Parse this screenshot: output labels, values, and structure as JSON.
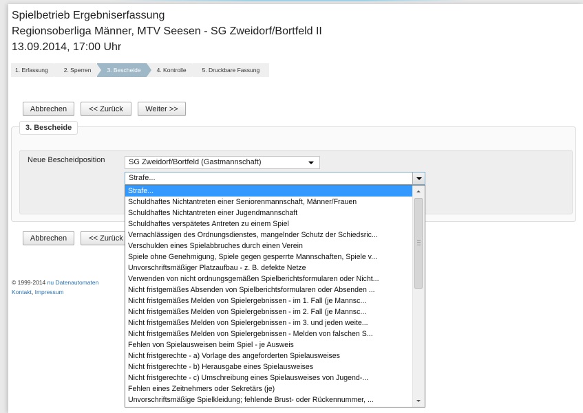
{
  "header": {
    "line1": "Spielbetrieb Ergebniserfassung",
    "line2": "Regionsoberliga Männer, MTV Seesen - SG Zweidorf/Bortfeld II",
    "line3": "13.09.2014, 17:00 Uhr"
  },
  "steps": [
    {
      "label": "1. Erfassung",
      "active": false
    },
    {
      "label": "2. Sperren",
      "active": false
    },
    {
      "label": "3. Bescheide",
      "active": true
    },
    {
      "label": "4. Kontrolle",
      "active": false
    },
    {
      "label": "5. Druckbare Fassung",
      "active": false
    }
  ],
  "buttons": {
    "cancel": "Abbrechen",
    "back": "<< Zurück",
    "next": "Weiter >>"
  },
  "section": {
    "legend": "3. Bescheide",
    "field_label": "Neue Bescheidposition",
    "team_select_value": "SG Zweidorf/Bortfeld (Gastmannschaft)",
    "strafe_select_value": "Strafe..."
  },
  "strafe_options": [
    "Strafe...",
    "Schuldhaftes Nichtantreten einer Seniorenmannschaft, Männer/Frauen",
    "Schuldhaftes Nichtantreten einer Jugendmannschaft",
    "Schuldhaftes verspätetes Antreten zu einem Spiel",
    "Vernachlässigen des Ordnungsdienstes, mangelnder Schutz der Schiedsric...",
    "Verschulden eines Spielabbruches durch einen Verein",
    "Spiele ohne Genehmigung, Spiele gegen gesperrte Mannschaften, Spiele v...",
    "Unvorschriftsmäßiger Platzaufbau - z. B. defekte Netze",
    "Verwenden von nicht ordnungsgemäßen Spielberichtsformularen oder Nicht...",
    "Nicht fristgemäßes Absenden von Spielberichtsformularen oder Absenden ...",
    "Nicht fristgemäßes Melden von Spielergebnissen - im 1. Fall (je Mannsc...",
    "Nicht fristgemäßes Melden von Spielergebnissen - im 2. Fall (je Mannsc...",
    "Nicht fristgemäßes Melden von Spielergebnissen - im 3. und jeden weite...",
    "Nicht fristgemäßes Melden von Spielergebnissen - Melden von falschen S...",
    "Fehlen von Spielausweisen beim Spiel - je Ausweis",
    "Nicht fristgerechte - a) Vorlage des angeforderten Spielausweises",
    "Nicht fristgerechte - b) Herausgabe eines Spielausweises",
    "Nicht fristgerechte - c) Umschreibung eines Spielausweises von Jugend-...",
    "Fehlen eines Zeitnehmers oder Sekretärs (je)",
    "Unvorschriftsmäßige Spielkleidung; fehlende Brust- oder Rückennummer, ..."
  ],
  "selected_option_index": 0,
  "footer": {
    "copyright": "© 1999-2014",
    "company_link": "nu Datenautomaten",
    "contact_link": "Kontakt",
    "separator": ",",
    "imprint_link": "Impressum"
  },
  "colors": {
    "active_step": "#9fb8c7",
    "selected_option": "#3399ff",
    "link": "#2a6fb0"
  }
}
